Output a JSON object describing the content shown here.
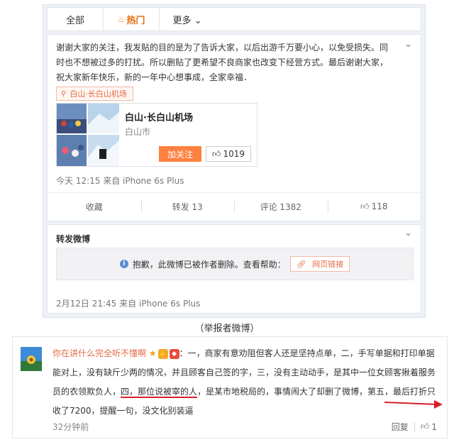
{
  "tabs": {
    "all": "全部",
    "hot": "热门",
    "more": "更多 ⌄"
  },
  "post": {
    "text": "谢谢大家的关注，我发贴的目的是为了告诉大家，以后出游千万要小心，以免受损失。同时也不想被过多的打扰。所以删贴了更希望不良商家也改变下经营方式。最后谢谢大家，祝大家新年快乐，新的一年中心想事成，全家幸福．",
    "location_tag": "白山·长白山机场",
    "place_name": "白山·长白山机场",
    "place_city": "白山市",
    "follow_label": "加关注",
    "like_count": "1019",
    "meta": "今天 12:15 来自 iPhone 6s Plus",
    "actions": {
      "favorite": "收藏",
      "repost": "转发 13",
      "comment": "评论 1382",
      "like": "118"
    }
  },
  "repost": {
    "title": "转发微博",
    "notice": "抱歉，此微博已被作者删除。查看帮助：",
    "link": "网页链接",
    "meta": "2月12日 21:45 来自 iPhone 6s Plus"
  },
  "caption": "（举报者微博）",
  "comment": {
    "username": "你在讲什么完全听不懂啊",
    "text_part1": "：一，商家有意劝阻但客人还是坚持点单，二，手写单据和打印单据能对上，没有缺斤少两的情况，并且顾客自己签的字，三，没有主动动手，是其中一位女顾客揪着服务员的衣领欺负人，",
    "text_highlight": "四，那位说被宰的人",
    "text_part2": "，是某市地税局的，事情闹大了却删了微博，第五，最后打折只收了7200，提醒一句，没文化别装逼",
    "time": "32分钟前",
    "reply": "回复",
    "likes": "1"
  },
  "colors": {
    "accent": "#e86a0e",
    "link": "#e56a45",
    "follow": "#ff8140",
    "annotation": "#d6202a"
  },
  "icons": [
    "chevron-down-icon",
    "location-pin-icon",
    "thumb-up-icon",
    "info-icon",
    "link-icon",
    "star-icon"
  ]
}
